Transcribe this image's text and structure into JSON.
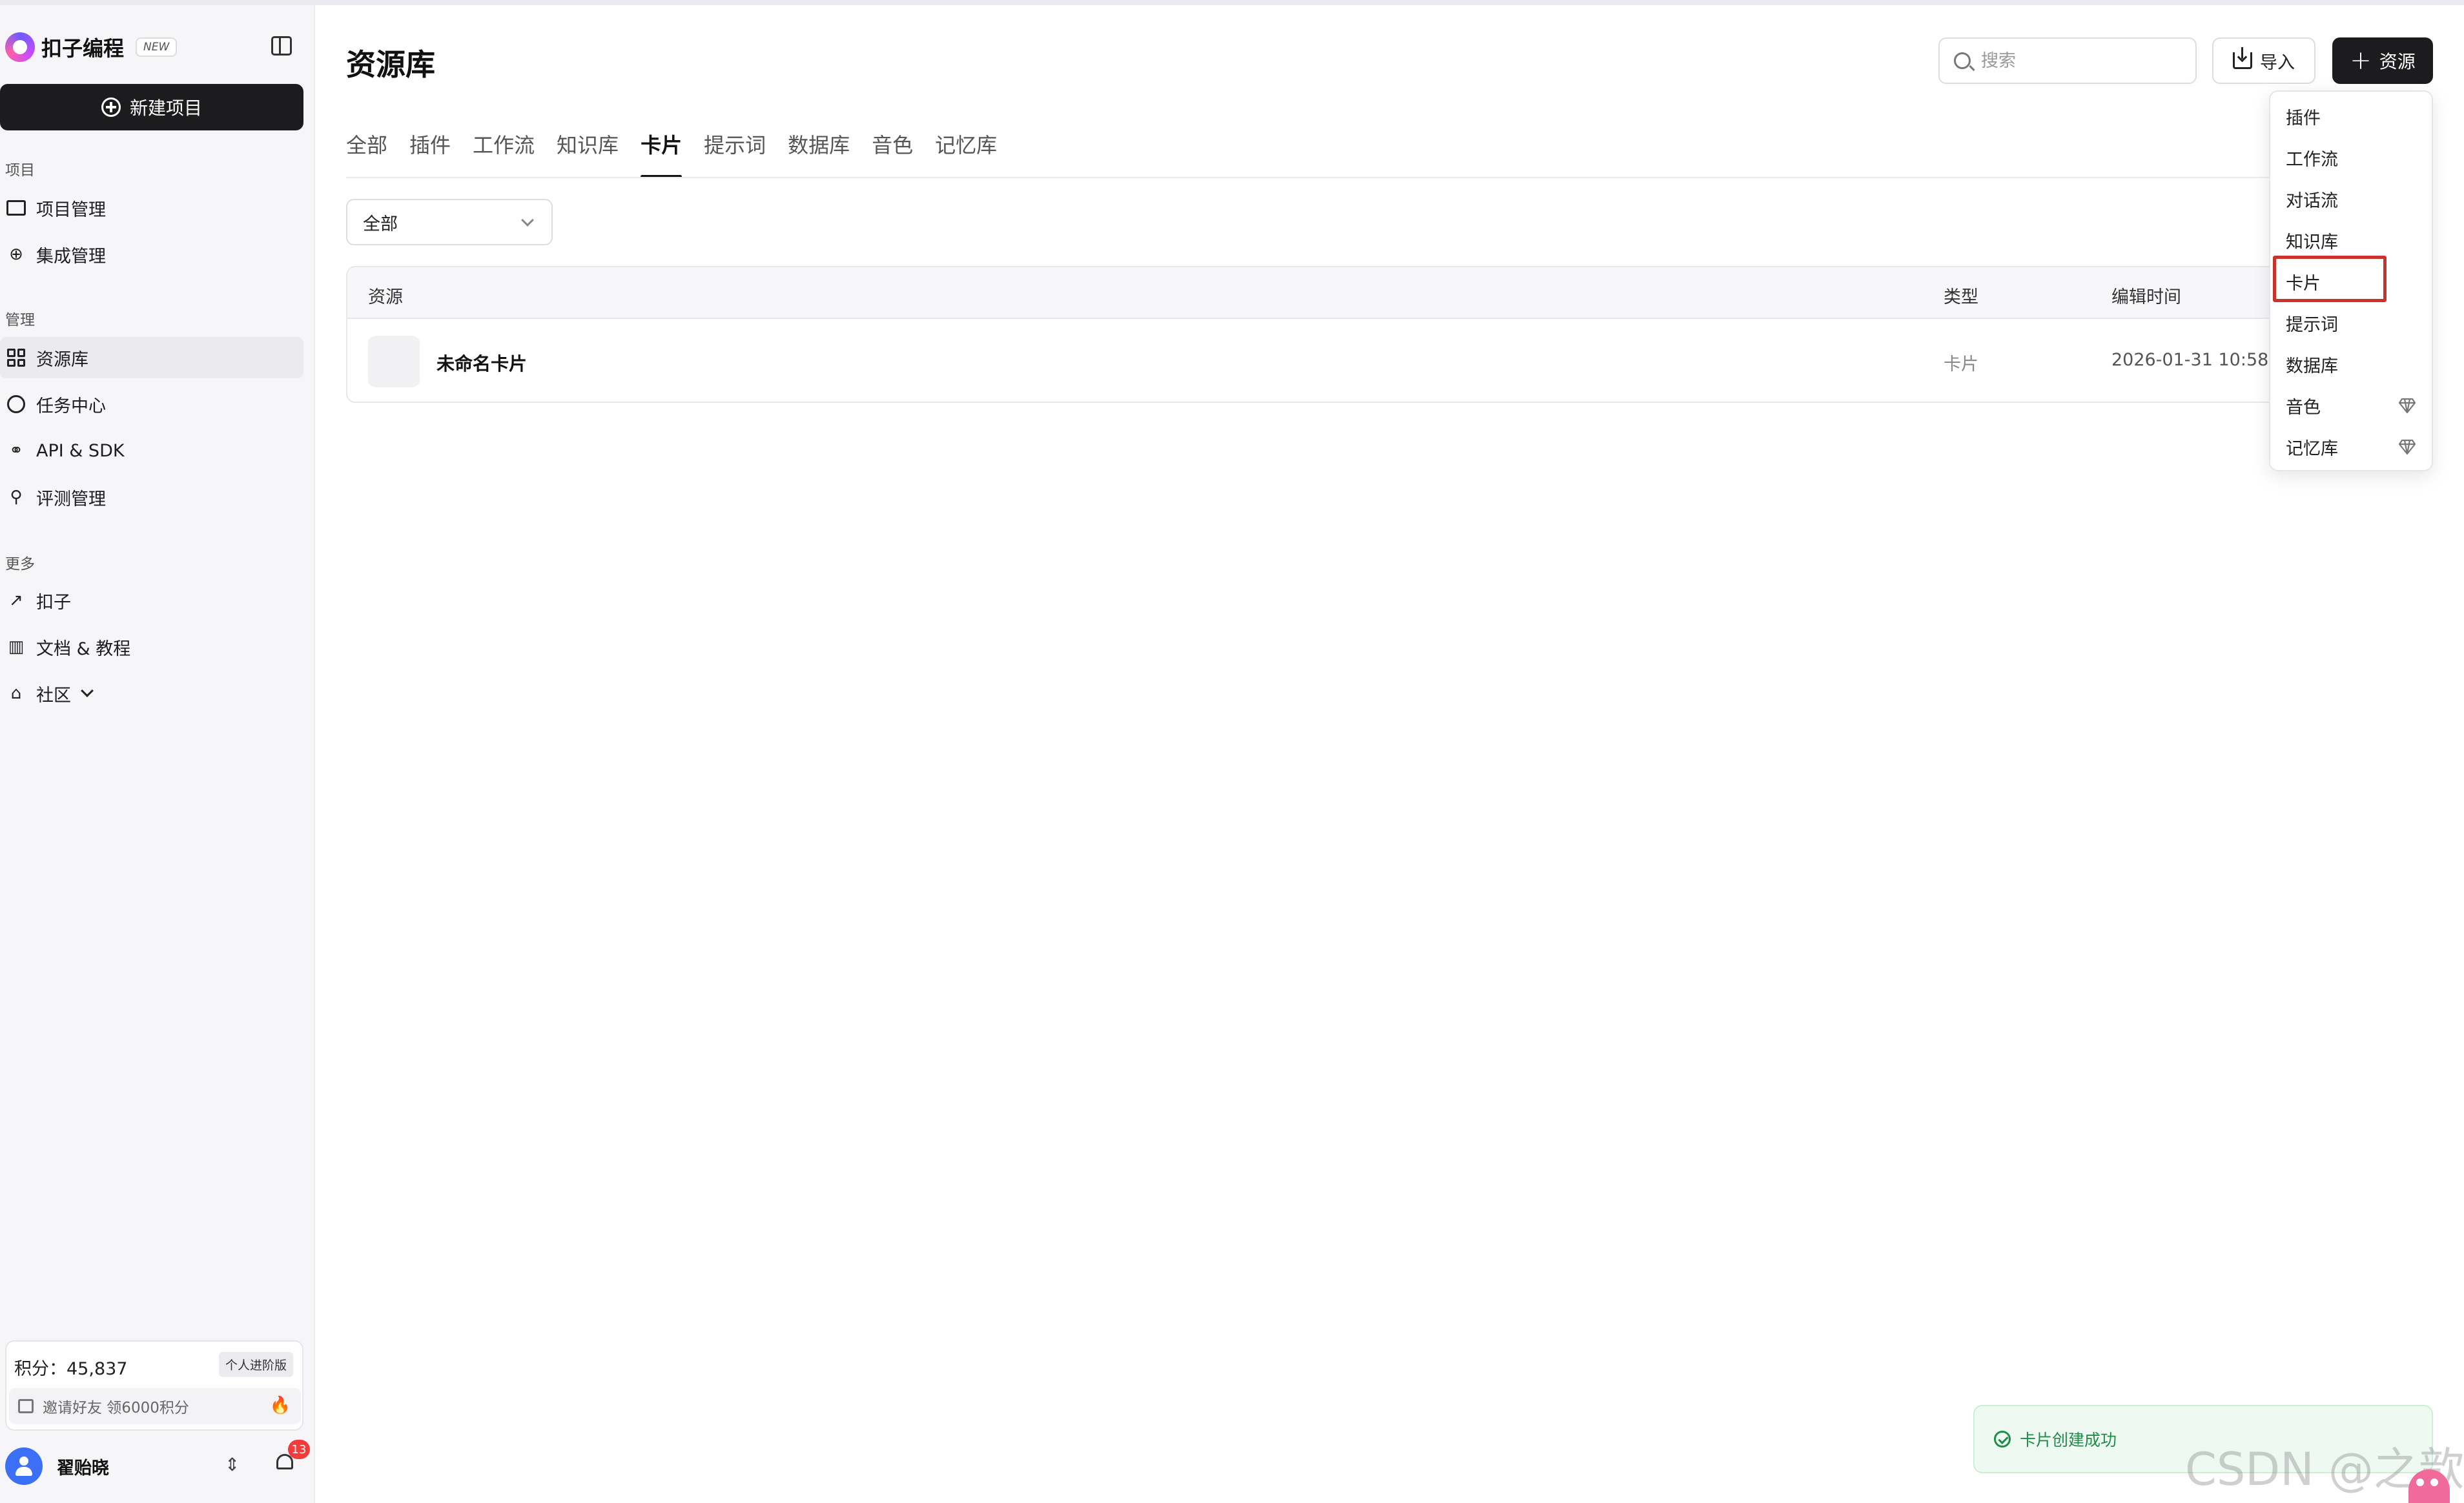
{
  "sidebar": {
    "brand_name": "扣子编程",
    "brand_badge": "NEW",
    "new_project": "新建项目",
    "sections": {
      "project": "项目",
      "manage": "管理",
      "more": "更多"
    },
    "items": [
      {
        "label": "项目管理"
      },
      {
        "label": "集成管理"
      },
      {
        "label": "资源库"
      },
      {
        "label": "任务中心"
      },
      {
        "label": "API & SDK"
      },
      {
        "label": "评测管理"
      },
      {
        "label": "扣子"
      },
      {
        "label": "文档 & 教程"
      },
      {
        "label": "社区"
      }
    ],
    "points_label": "积分：45,837",
    "plan_badge": "个人进阶版",
    "invite_text": "邀请好友 领6000积分",
    "user_name": "翟贻晓",
    "notification_count": "13"
  },
  "header": {
    "title": "资源库",
    "search_placeholder": "搜索",
    "import_label": "导入",
    "add_label": "资源"
  },
  "tabs": [
    "全部",
    "插件",
    "工作流",
    "知识库",
    "卡片",
    "提示词",
    "数据库",
    "音色",
    "记忆库"
  ],
  "active_tab": "卡片",
  "filter": {
    "selected": "全部"
  },
  "table": {
    "columns": [
      "资源",
      "类型",
      "编辑时间"
    ],
    "rows": [
      {
        "name": "未命名卡片",
        "type": "卡片",
        "time": "2026-01-31 10:58:"
      }
    ]
  },
  "dropdown": {
    "items": [
      "插件",
      "工作流",
      "对话流",
      "知识库",
      "卡片",
      "提示词",
      "数据库",
      "音色",
      "记忆库"
    ],
    "highlighted": "卡片"
  },
  "toast": {
    "message": "卡片创建成功"
  },
  "watermark": "CSDN @之歆",
  "colors": {
    "accent_dark": "#1c1c1e",
    "highlight_border": "#c8332b",
    "toast_green": "#1f8d48",
    "avatar_blue": "#3b6ff5"
  }
}
